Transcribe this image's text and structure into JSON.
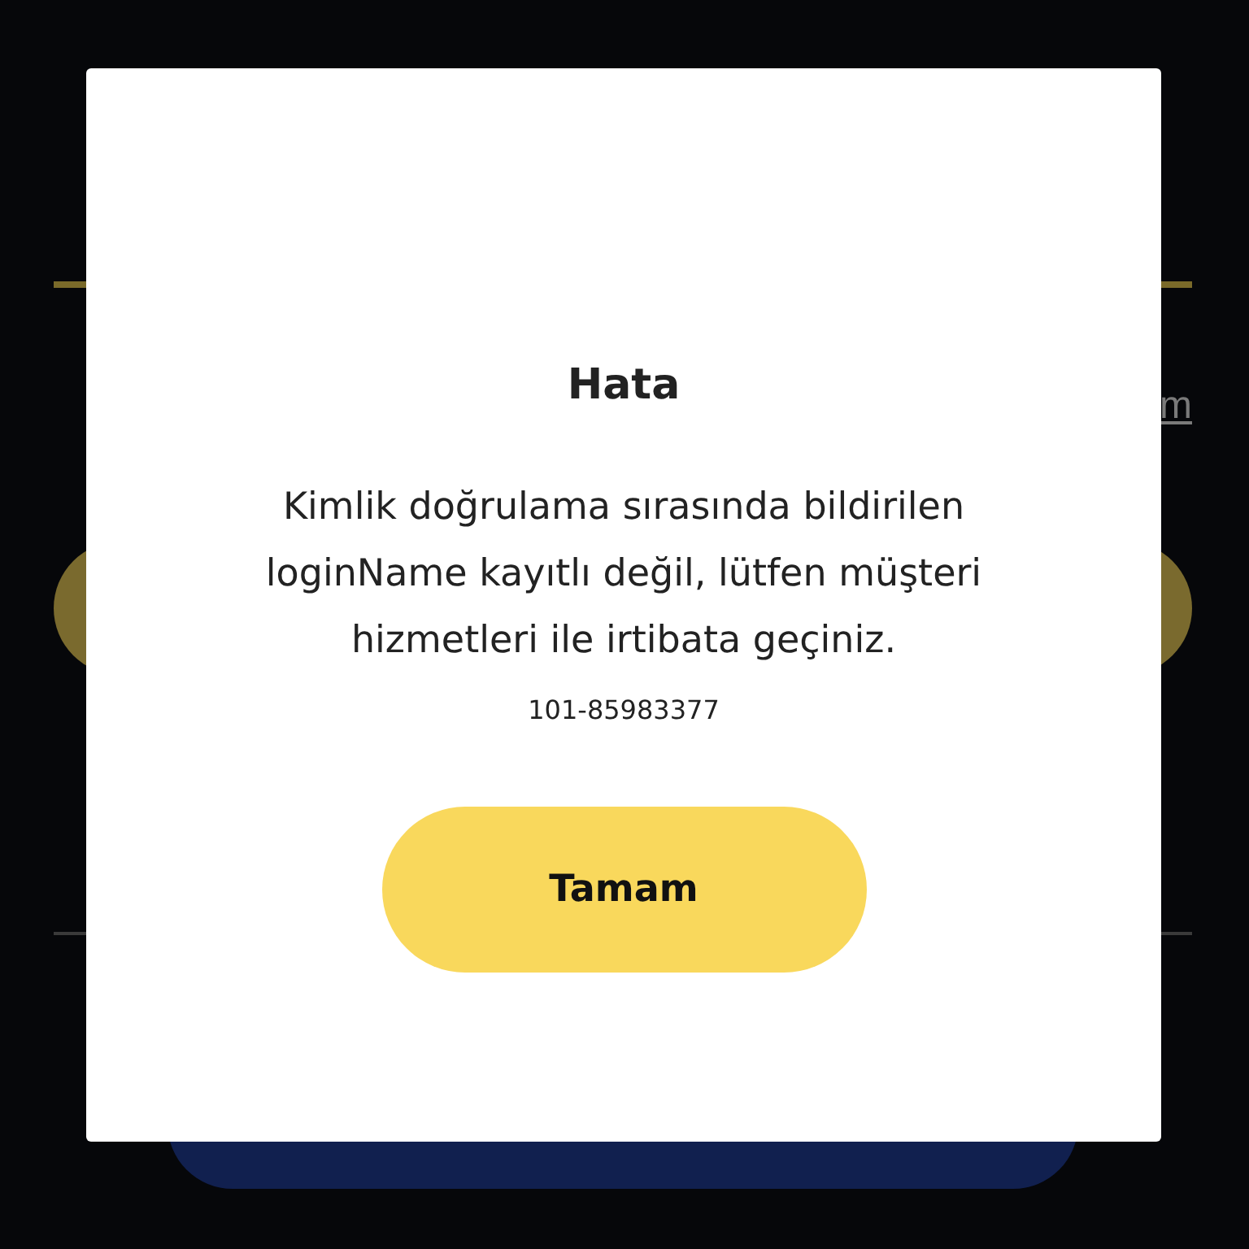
{
  "background": {
    "link_fragment": "m"
  },
  "dialog": {
    "title": "Hata",
    "message": "Kimlik doğrulama sırasında bildirilen loginName kayıtlı değil, lütfen müşteri hizmetleri ile irtibata geçiniz.",
    "error_code": "101-85983377",
    "button": "Tamam"
  }
}
